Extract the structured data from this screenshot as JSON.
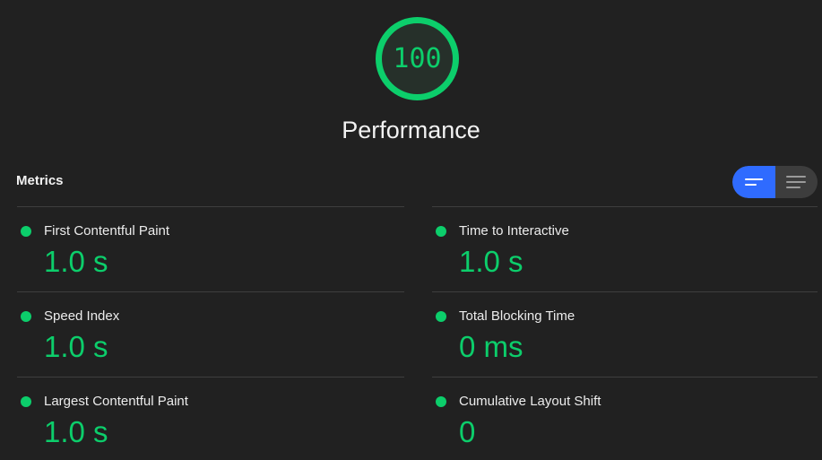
{
  "gauge": {
    "score": "100",
    "category": "Performance"
  },
  "metrics_section": {
    "heading": "Metrics",
    "view_toggle": {
      "options": [
        "compact-view",
        "expanded-view"
      ],
      "selected": "compact-view"
    },
    "items": [
      {
        "title": "First Contentful Paint",
        "value": "1.0 s",
        "status": "pass"
      },
      {
        "title": "Time to Interactive",
        "value": "1.0 s",
        "status": "pass"
      },
      {
        "title": "Speed Index",
        "value": "1.0 s",
        "status": "pass"
      },
      {
        "title": "Total Blocking Time",
        "value": "0 ms",
        "status": "pass"
      },
      {
        "title": "Largest Contentful Paint",
        "value": "1.0 s",
        "status": "pass"
      },
      {
        "title": "Cumulative Layout Shift",
        "value": "0",
        "status": "pass"
      }
    ]
  },
  "colors": {
    "background": "#212121",
    "pass": "#0cce6b",
    "toggle_active": "#2f6bff",
    "divider": "#3e3e3e"
  }
}
